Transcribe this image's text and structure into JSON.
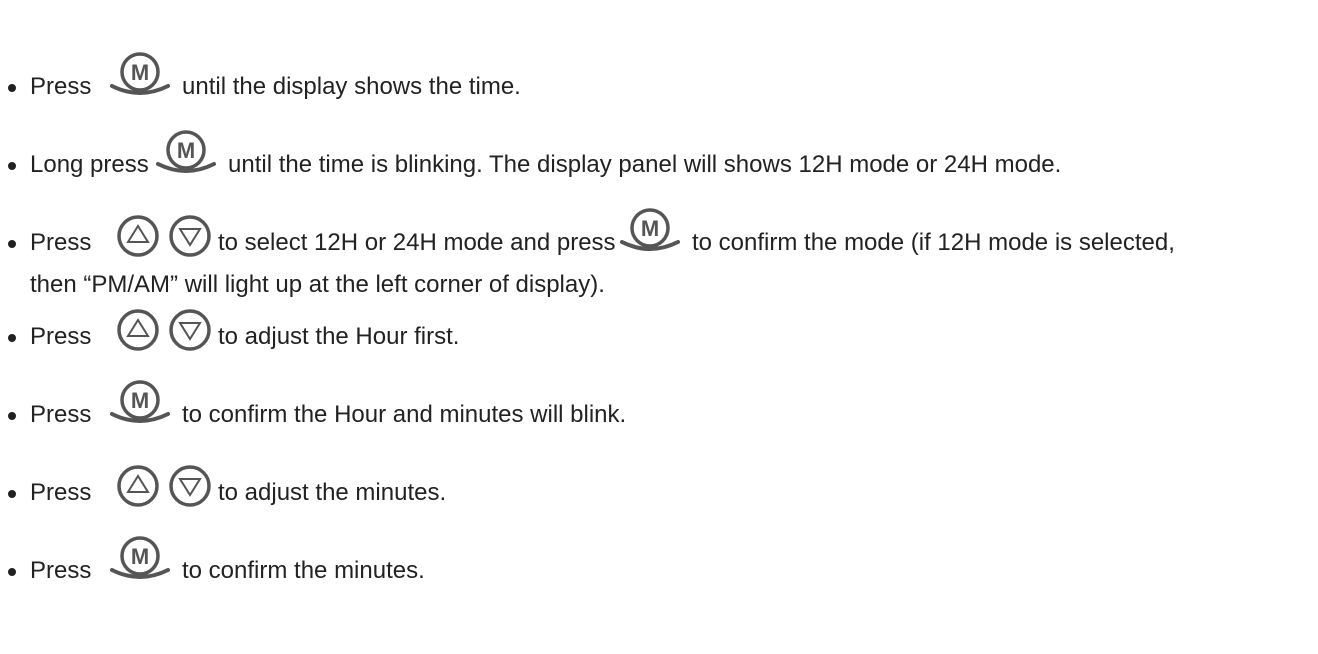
{
  "steps": [
    {
      "segments": [
        {
          "type": "text",
          "text": "Press"
        },
        {
          "type": "icon",
          "icon": "m-button-icon"
        },
        {
          "type": "text",
          "text": "until the display shows the time."
        }
      ]
    },
    {
      "segments": [
        {
          "type": "text",
          "text": "Long press"
        },
        {
          "type": "icon",
          "icon": "m-button-icon"
        },
        {
          "type": "text",
          "text": "until the time is blinking. The display panel will shows 12H mode or 24H mode."
        }
      ]
    },
    {
      "segments": [
        {
          "type": "text",
          "text": "Press"
        },
        {
          "type": "icon",
          "icon": "up-button-icon"
        },
        {
          "type": "icon",
          "icon": "down-button-icon"
        },
        {
          "type": "text",
          "text": "to select 12H or 24H mode and press"
        },
        {
          "type": "icon",
          "icon": "m-button-icon"
        },
        {
          "type": "text",
          "text": "to confirm the mode (if 12H mode is selected,"
        }
      ],
      "continuation": "then “PM/AM” will light up at the left corner of display)."
    },
    {
      "segments": [
        {
          "type": "text",
          "text": "Press"
        },
        {
          "type": "icon",
          "icon": "up-button-icon"
        },
        {
          "type": "icon",
          "icon": "down-button-icon"
        },
        {
          "type": "text",
          "text": "to adjust the Hour first."
        }
      ]
    },
    {
      "segments": [
        {
          "type": "text",
          "text": "Press"
        },
        {
          "type": "icon",
          "icon": "m-button-icon"
        },
        {
          "type": "text",
          "text": "to confirm the Hour and minutes will blink."
        }
      ]
    },
    {
      "segments": [
        {
          "type": "text",
          "text": "Press"
        },
        {
          "type": "icon",
          "icon": "up-button-icon"
        },
        {
          "type": "icon",
          "icon": "down-button-icon"
        },
        {
          "type": "text",
          "text": "to adjust the minutes."
        }
      ]
    },
    {
      "segments": [
        {
          "type": "text",
          "text": "Press"
        },
        {
          "type": "icon",
          "icon": "m-button-icon"
        },
        {
          "type": "text",
          "text": "to confirm the minutes."
        }
      ]
    }
  ],
  "colors": {
    "text": "#222222",
    "icon_stroke": "#555555",
    "icon_fill": "#ffffff",
    "background": "#ffffff"
  }
}
